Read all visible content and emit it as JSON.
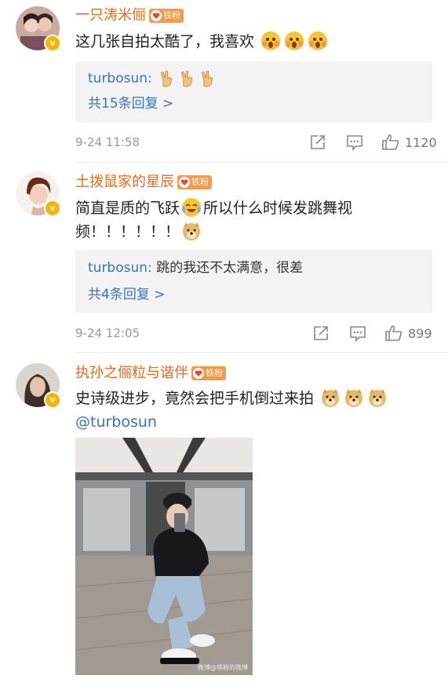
{
  "comments": [
    {
      "username": "一只涛米俪",
      "fan_badge": "铁粉",
      "text": "这几张自拍太酷了，我喜欢",
      "emojis": [
        "shocked-emoji",
        "shocked-emoji",
        "shocked-emoji"
      ],
      "reply_author": "turbosun:",
      "reply_text": "",
      "reply_emojis": [
        "victory-hand-emoji",
        "victory-hand-emoji",
        "victory-hand-emoji"
      ],
      "more_replies": "共15条回复 >",
      "time": "9-24 11:58",
      "likes": "1120"
    },
    {
      "username": "土拨鼠家的星辰",
      "fan_badge": "铁粉",
      "text_part1": "简直是质的飞跃",
      "text_part2": "所以什么时候发跳舞视",
      "text_part3": "频！！！！！！",
      "reply_author": "turbosun:",
      "reply_text": " 跳的我还不太满意，很差",
      "more_replies": "共4条回复 >",
      "time": "9-24 12:05",
      "likes": "899"
    },
    {
      "username": "执孙之俪粒与谐伴",
      "fan_badge": "铁粉",
      "text": "史诗级进步，竟然会把手机倒过来拍",
      "mention": "@turbosun",
      "photo_watermark": "微博@铁粉的微博"
    }
  ],
  "colors": {
    "username": "#e86c1a",
    "link": "#3b74b8",
    "badge": "#f29b4c",
    "verified": "#f7b500"
  }
}
